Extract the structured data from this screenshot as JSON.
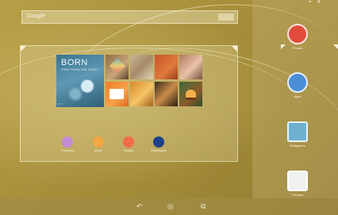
{
  "status_bar": {
    "icons": "⏷ ▮"
  },
  "search": {
    "label": "Google"
  },
  "photo_widget": {
    "album_title": "BORN",
    "album_subtitle": "FREE FROM THE START",
    "album_page_dots": "• • •"
  },
  "dock": [
    {
      "name": "Podcasts",
      "color": "#c58ad6"
    },
    {
      "name": "Music",
      "color": "#f3a742"
    },
    {
      "name": "Photos",
      "color": "#f26c4c"
    },
    {
      "name": "PlayStation",
      "color": "#1f3f8a"
    }
  ],
  "side_panel": [
    {
      "name": "Photos",
      "color": "#e24b3a"
    },
    {
      "name": "Apps",
      "color": "#4b8fd6"
    },
    {
      "name": "Wallpapers",
      "color": "#6fb0d0"
    },
    {
      "name": "Themes",
      "color": "#f0f0f0"
    }
  ],
  "navbar": {
    "back": "↶",
    "home": "◎",
    "recents": "⧉"
  }
}
